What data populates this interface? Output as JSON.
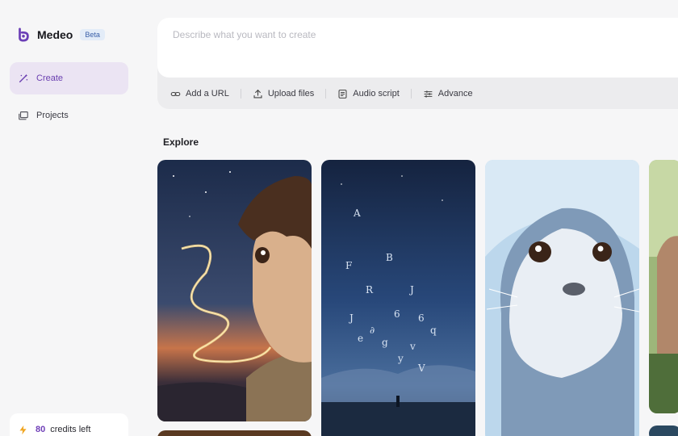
{
  "app": {
    "name": "Medeo",
    "badge": "Beta"
  },
  "sidebar": {
    "items": [
      {
        "label": "Create",
        "icon": "magic-wand-icon",
        "active": true
      },
      {
        "label": "Projects",
        "icon": "folder-stack-icon",
        "active": false
      }
    ],
    "credits": {
      "count": "80",
      "label": "credits left",
      "icon": "lightning-icon"
    }
  },
  "prompt": {
    "placeholder": "Describe what you want to create",
    "value": "",
    "actions": [
      {
        "label": "Add a URL",
        "icon": "link-icon"
      },
      {
        "label": "Upload files",
        "icon": "upload-icon"
      },
      {
        "label": "Audio script",
        "icon": "document-icon"
      },
      {
        "label": "Advance",
        "icon": "sliders-icon"
      }
    ]
  },
  "explore": {
    "title": "Explore",
    "cards": [
      {
        "subject": "anime boy with glowing music notes at dusk"
      },
      {
        "subject": "night sky with floating letters over a field"
      },
      {
        "subject": "close-up of a fluffy baby seal"
      },
      {
        "subject": "person in a garden"
      }
    ]
  },
  "colors": {
    "accent": "#7040b8",
    "active_bg": "#ebe4f3",
    "background": "#f6f6f7"
  }
}
